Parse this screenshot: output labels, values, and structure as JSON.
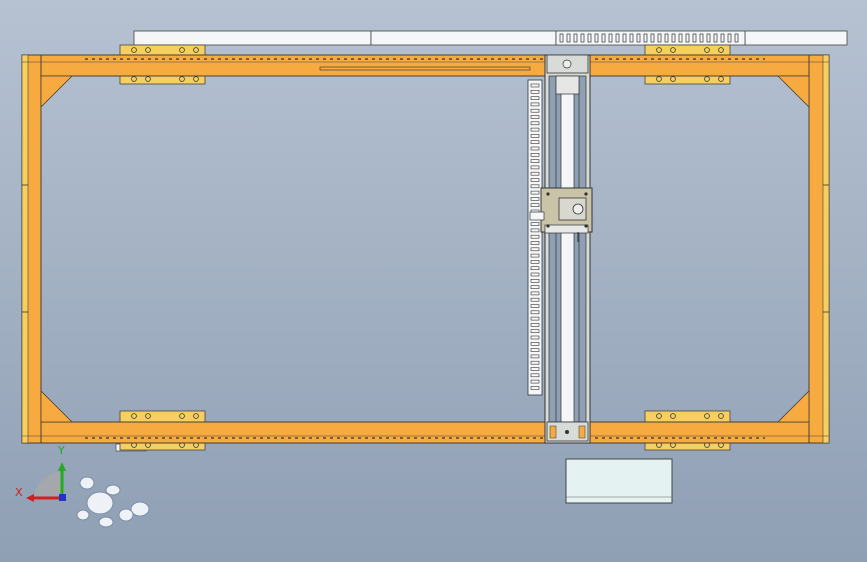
{
  "viewport": {
    "background_top": "#b6c2d2",
    "background_bottom": "#8f9fb4"
  },
  "colors": {
    "frame": "#f7aa3f",
    "frame_outline": "#4a4030",
    "mount_pad": "#f5d060",
    "rail_white": "#f4f6f8",
    "steel": "#d8dcd8",
    "carriage": "#c9c4a8",
    "box": "#e4f2f2"
  },
  "triad": {
    "x_label": "X",
    "y_label": "Y",
    "x_color": "#cc2222",
    "y_color": "#22aa22",
    "z_color": "#2233cc"
  },
  "icons": {
    "view_orientation": "view-orientation-triad-icon",
    "figure": "viewer-figure-icon"
  }
}
